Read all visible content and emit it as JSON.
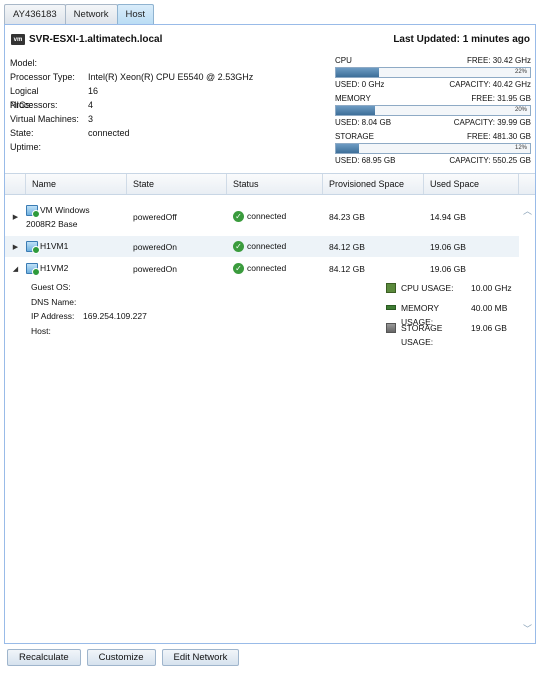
{
  "tabs": [
    "AY436183",
    "Network",
    "Host"
  ],
  "host": {
    "badge": "vm",
    "name": "SVR-ESXI-1.altimatech.local",
    "last_updated": "Last Updated: 1 minutes ago",
    "info": [
      {
        "label": "Model:",
        "value": ""
      },
      {
        "label": "Processor Type:",
        "value": "Intel(R) Xeon(R) CPU E5540 @ 2.53GHz"
      },
      {
        "label": "Logical Processors:",
        "value": "16"
      },
      {
        "label": "NICs:",
        "value": "4"
      },
      {
        "label": "Virtual Machines:",
        "value": "3"
      },
      {
        "label": "State:",
        "value": "connected"
      },
      {
        "label": "Uptime:",
        "value": ""
      }
    ]
  },
  "meters": [
    {
      "name": "CPU",
      "free": "FREE: 30.42 GHz",
      "pct": 22,
      "pct_label": "22%",
      "used": "USED: 0 GHz",
      "capacity": "CAPACITY: 40.42 GHz"
    },
    {
      "name": "MEMORY",
      "free": "FREE: 31.95 GB",
      "pct": 20,
      "pct_label": "20%",
      "used": "USED: 8.04 GB",
      "capacity": "CAPACITY: 39.99 GB"
    },
    {
      "name": "STORAGE",
      "free": "FREE: 481.30 GB",
      "pct": 12,
      "pct_label": "12%",
      "used": "USED: 68.95 GB",
      "capacity": "CAPACITY: 550.25 GB"
    }
  ],
  "grid": {
    "columns": [
      "Name",
      "State",
      "Status",
      "Provisioned Space",
      "Used Space"
    ],
    "rows": [
      {
        "name_line1": "VM Windows",
        "name_line2": "2008R2 Base",
        "state": "poweredOff",
        "status": "connected",
        "provisioned": "84.23 GB",
        "used": "14.94 GB",
        "expanded": false
      },
      {
        "name_line1": "H1VM1",
        "name_line2": "",
        "state": "poweredOn",
        "status": "connected",
        "provisioned": "84.12 GB",
        "used": "19.06 GB",
        "expanded": false
      },
      {
        "name_line1": "H1VM2",
        "name_line2": "",
        "state": "poweredOn",
        "status": "connected",
        "provisioned": "84.12 GB",
        "used": "19.06 GB",
        "expanded": true
      }
    ],
    "details": [
      {
        "label": "Guest OS:",
        "value": ""
      },
      {
        "label": "DNS Name:",
        "value": ""
      },
      {
        "label": "IP Address:",
        "value": "169.254.109.227"
      },
      {
        "label": "Host:",
        "value": ""
      }
    ],
    "usage": [
      {
        "label": "CPU USAGE:",
        "value": "10.00 GHz"
      },
      {
        "label": "MEMORY USAGE:",
        "value": "40.00 MB"
      },
      {
        "label": "STORAGE USAGE:",
        "value": "19.06 GB"
      }
    ]
  },
  "buttons": [
    "Recalculate",
    "Customize",
    "Edit Network"
  ]
}
